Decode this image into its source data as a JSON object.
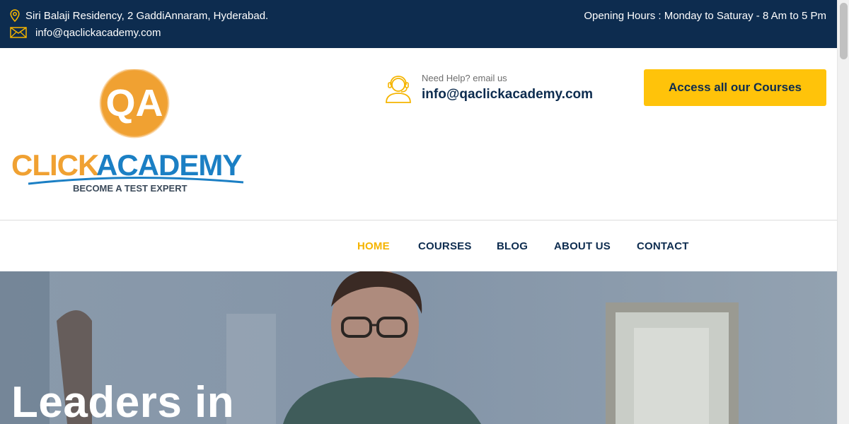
{
  "topbar": {
    "address": "Siri Balaji Residency, 2 GaddiAnnaram, Hyderabad.",
    "email": "info@qaclickacademy.com",
    "hours": "Opening Hours : Monday to Saturay - 8 Am to 5 Pm",
    "icons": {
      "location": "location-pin-icon",
      "mail": "envelope-icon"
    },
    "colors": {
      "background": "#0d2c4f",
      "icon": "#f5b400"
    }
  },
  "logo": {
    "monogram": "QA",
    "wordmark_left": "CLICK",
    "wordmark_right": "ACADEMY",
    "tagline": "BECOME A TEST EXPERT",
    "colors": {
      "orange": "#f0a132",
      "blue": "#1b7fc4",
      "tagline": "#3b4a5a"
    }
  },
  "help": {
    "label": "Need Help? email us",
    "email": "info@qaclickacademy.com",
    "icon": "support-agent-icon"
  },
  "cta": {
    "label": "Access all our Courses",
    "color": "#ffc30a"
  },
  "nav": {
    "items": [
      {
        "label": "HOME",
        "active": true
      },
      {
        "label": "COURSES",
        "active": false
      },
      {
        "label": "BLOG",
        "active": false
      },
      {
        "label": "ABOUT US",
        "active": false
      },
      {
        "label": "CONTACT",
        "active": false
      }
    ],
    "active_color": "#f5b400",
    "text_color": "#0d2c4f"
  },
  "hero": {
    "title": "Leaders in"
  }
}
